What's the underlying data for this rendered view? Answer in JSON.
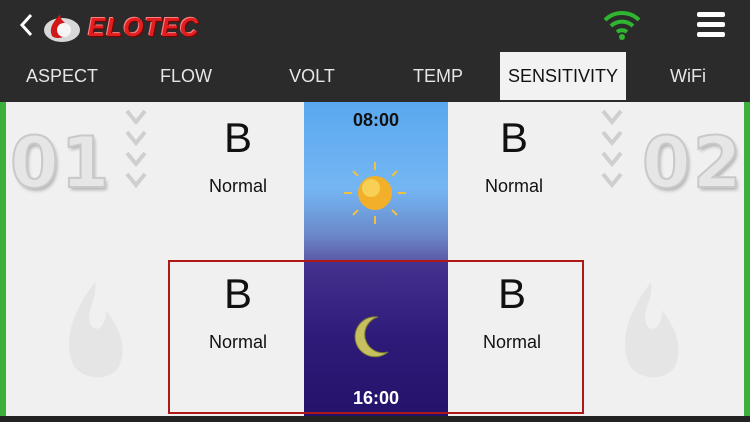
{
  "header": {
    "back_icon": "chevron-left-icon",
    "logo_icon": "elotec-flame-logo-icon",
    "brand": "ELOTEC",
    "wifi_icon": "wifi-icon",
    "wifi_color": "#2fb52f",
    "menu_icon": "hamburger-menu-icon",
    "brand_color": "#e02020"
  },
  "tabs": [
    {
      "label": "ASPECT",
      "active": false
    },
    {
      "label": "FLOW",
      "active": false
    },
    {
      "label": "VOLT",
      "active": false
    },
    {
      "label": "TEMP",
      "active": false
    },
    {
      "label": "SENSITIVITY",
      "active": true
    },
    {
      "label": "WiFi",
      "active": false
    }
  ],
  "zones": [
    {
      "number": "01"
    },
    {
      "number": "02"
    }
  ],
  "schedule": {
    "day_start": "08:00",
    "night_start": "16:00",
    "day_icon": "sun-icon",
    "night_icon": "moon-icon"
  },
  "settings": {
    "zone1_day": {
      "level": "B",
      "mode": "Normal"
    },
    "zone2_day": {
      "level": "B",
      "mode": "Normal"
    },
    "zone1_night": {
      "level": "B",
      "mode": "Normal"
    },
    "zone2_night": {
      "level": "B",
      "mode": "Normal"
    }
  },
  "colors": {
    "accent_green": "#3bb03b",
    "selection_red": "#b01818"
  }
}
